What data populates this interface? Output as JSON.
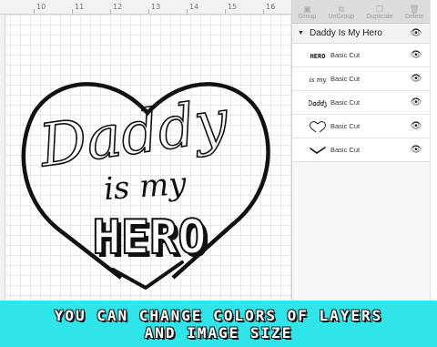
{
  "ruler": {
    "numbers": [
      "10",
      "11",
      "12",
      "13",
      "14",
      "15",
      "16"
    ]
  },
  "design": {
    "line1": "Daddy",
    "line2": "is my",
    "line3": "HERO"
  },
  "toolbar": {
    "group_label": "Group",
    "ungroup_label": "UnGroup",
    "duplicate_label": "Duplicate",
    "delete_label": "Delete"
  },
  "layers": {
    "group_name": "Daddy Is My Hero",
    "items": [
      {
        "thumb": "hero-thumb-icon",
        "label": "Basic Cut"
      },
      {
        "thumb": "is-my-thumb-icon",
        "label": "Basic Cut"
      },
      {
        "thumb": "daddy-thumb-icon",
        "label": "Basic Cut"
      },
      {
        "thumb": "heart-thumb-icon",
        "label": "Basic Cut"
      },
      {
        "thumb": "check-thumb-icon",
        "label": "Basic Cut"
      }
    ]
  },
  "thumbs": {
    "hero": "HERO",
    "is_my": "is my",
    "daddy": "Daddy"
  },
  "banner": {
    "line1": "YOU CAN CHANGE COLORS OF LAYERS",
    "line2": "AND IMAGE SIZE"
  },
  "colors": {
    "banner_bg": "#2fe5ea",
    "ink": "#111111"
  }
}
